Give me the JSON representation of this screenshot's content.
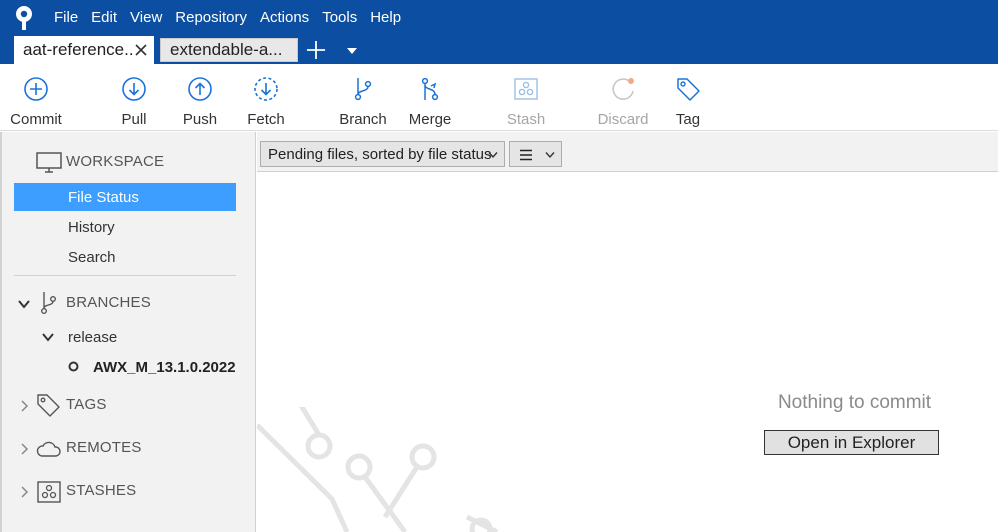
{
  "menu": {
    "items": [
      "File",
      "Edit",
      "View",
      "Repository",
      "Actions",
      "Tools",
      "Help"
    ]
  },
  "tabs": [
    {
      "label": "aat-reference.."
    },
    {
      "label": "extendable-a..."
    }
  ],
  "toolbar": {
    "commit": "Commit",
    "pull": "Pull",
    "push": "Push",
    "fetch": "Fetch",
    "branch": "Branch",
    "merge": "Merge",
    "stash": "Stash",
    "discard": "Discard",
    "tag": "Tag"
  },
  "sidebar": {
    "workspace": "WORKSPACE",
    "file_status": "File Status",
    "history": "History",
    "search": "Search",
    "branches": "BRANCHES",
    "branch_folder": "release",
    "current_branch": "AWX_M_13.1.0.2022",
    "tags": "TAGS",
    "remotes": "REMOTES",
    "stashes": "STASHES"
  },
  "main": {
    "sort_select": "Pending files, sorted by file status",
    "empty_message": "Nothing to commit",
    "open_explorer": "Open in Explorer"
  },
  "colors": {
    "titlebar": "#0c4ea1",
    "accent": "#1a73d9",
    "selection": "#3d9eff"
  }
}
